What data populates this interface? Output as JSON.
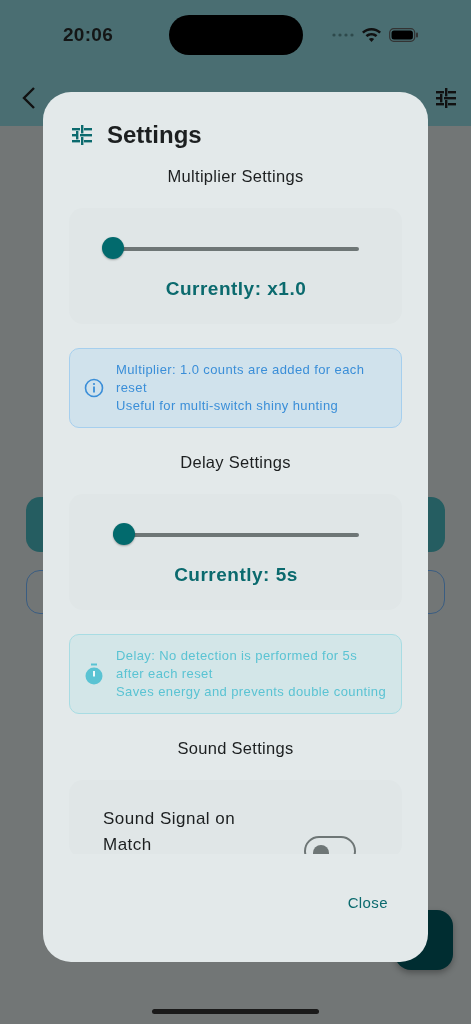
{
  "status_bar": {
    "time": "20:06"
  },
  "dialog": {
    "title": "Settings",
    "sections": [
      {
        "kind": "slider",
        "heading": "Multiplier Settings",
        "level": 0,
        "reading": "Currently: x1.0",
        "note": {
          "kind": "info",
          "lines": [
            "Multiplier: 1.0 counts are added for each reset",
            "Useful for multi-switch shiny hunting"
          ]
        }
      },
      {
        "kind": "slider",
        "heading": "Delay Settings",
        "level": 0.045,
        "reading": "Currently: 5s",
        "note": {
          "kind": "timer",
          "lines": [
            "Delay: No detection is performed for 5s after each reset",
            "Saves energy and prevents double counting"
          ]
        }
      },
      {
        "kind": "toggle",
        "heading": "Sound Settings",
        "label": "Sound Signal on Match",
        "on": false
      }
    ],
    "close_button": "Close"
  }
}
